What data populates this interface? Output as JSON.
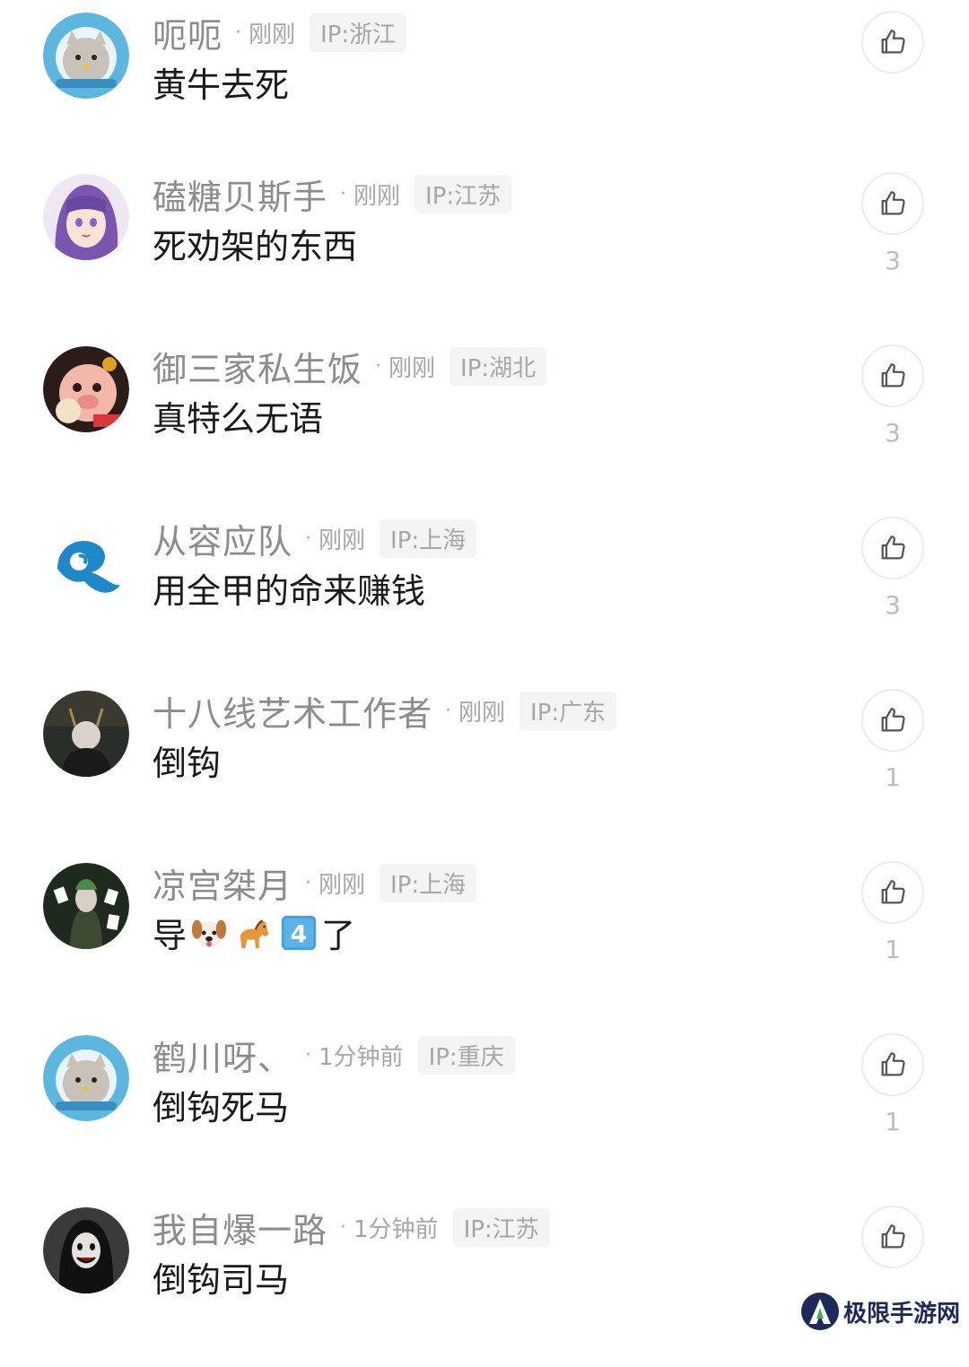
{
  "comments": [
    {
      "username": "呃呃",
      "time": "刚刚",
      "ip": "IP:浙江",
      "text": "黄牛去死",
      "likes": "",
      "avatar": "cat-astronaut-avatar"
    },
    {
      "username": "磕糖贝斯手",
      "time": "刚刚",
      "ip": "IP:江苏",
      "text": "死劝架的东西",
      "likes": "3",
      "avatar": "anime-girl-avatar"
    },
    {
      "username": "御三家私生饭",
      "time": "刚刚",
      "ip": "IP:湖北",
      "text": "真特么无语",
      "likes": "3",
      "avatar": "cartoon-pig-avatar"
    },
    {
      "username": "从容应队",
      "time": "刚刚",
      "ip": "IP:上海",
      "text": "用全甲的命来赚钱",
      "likes": "3",
      "avatar": "wave-logo-avatar"
    },
    {
      "username": "十八线艺术工作者",
      "time": "刚刚",
      "ip": "IP:广东",
      "text": "倒钩",
      "likes": "1",
      "avatar": "person-photo-avatar"
    },
    {
      "username": "凉宫桀月",
      "time": "刚刚",
      "ip": "IP:上海",
      "text_prefix": "导",
      "text_suffix": "了",
      "likes": "1",
      "avatar": "card-character-avatar",
      "emojis": [
        "dog-face-emoji",
        "horse-emoji",
        "keycap-4-emoji"
      ]
    },
    {
      "username": "鹤川呀、",
      "time": "1分钟前",
      "ip": "IP:重庆",
      "text": "倒钩死马",
      "likes": "1",
      "avatar": "cat-astronaut-avatar"
    },
    {
      "username": "我自爆一路",
      "time": "1分钟前",
      "ip": "IP:江苏",
      "text": "倒钩司马",
      "likes": "",
      "avatar": "dark-figure-avatar"
    }
  ],
  "icons": {
    "like": "thumbs-up-icon"
  },
  "colors": {
    "username": "#8c8c8c",
    "meta": "#a6a6a6",
    "text": "#1a1a1a",
    "ip_bg": "#f4f4f4",
    "like_border": "#ececec"
  },
  "watermark": {
    "text": "极限手游网"
  }
}
